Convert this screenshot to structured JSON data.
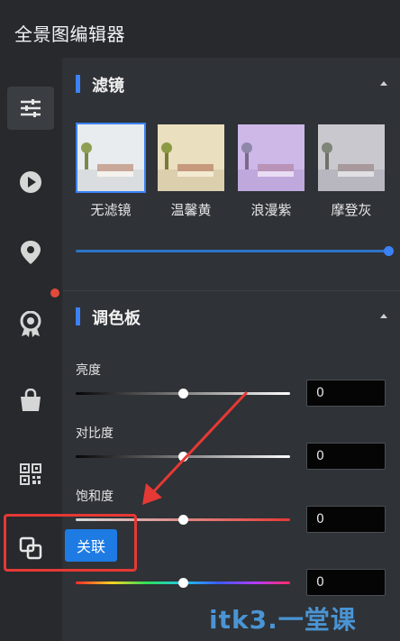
{
  "app": {
    "title": "全景图编辑器"
  },
  "sidebar": {
    "items": [
      {
        "name": "adjust",
        "icon": "sliders-icon",
        "active": true
      },
      {
        "name": "play",
        "icon": "play-circle-icon"
      },
      {
        "name": "location",
        "icon": "map-pin-icon"
      },
      {
        "name": "award",
        "icon": "award-icon"
      },
      {
        "name": "bag",
        "icon": "shopping-bag-icon"
      },
      {
        "name": "qrcode",
        "icon": "qrcode-icon"
      },
      {
        "name": "link",
        "icon": "link-squares-icon"
      }
    ]
  },
  "filters_section": {
    "title": "滤镜",
    "items": [
      {
        "label": "无滤镜",
        "selected": true,
        "tint": "#e8ecef"
      },
      {
        "label": "温馨黄",
        "selected": false,
        "tint": "#eadfbf"
      },
      {
        "label": "浪漫紫",
        "selected": false,
        "tint": "#cdb8e8"
      },
      {
        "label": "摩登灰",
        "selected": false,
        "tint": "#c9c8cf"
      }
    ],
    "intensity": 1.0
  },
  "palette_section": {
    "title": "调色板",
    "controls": [
      {
        "label": "亮度",
        "value": "0",
        "level": 0.5
      },
      {
        "label": "对比度",
        "value": "0",
        "level": 0.5
      },
      {
        "label": "饱和度",
        "value": "0",
        "level": 0.5
      },
      {
        "label": "",
        "value": "0",
        "level": 0.5
      }
    ]
  },
  "tooltip": {
    "label": "关联"
  },
  "watermark": {
    "text": "itk3.一堂课"
  },
  "colors": {
    "accent": "#3b82f6",
    "highlight": "#e53935",
    "button": "#1e7be3"
  }
}
